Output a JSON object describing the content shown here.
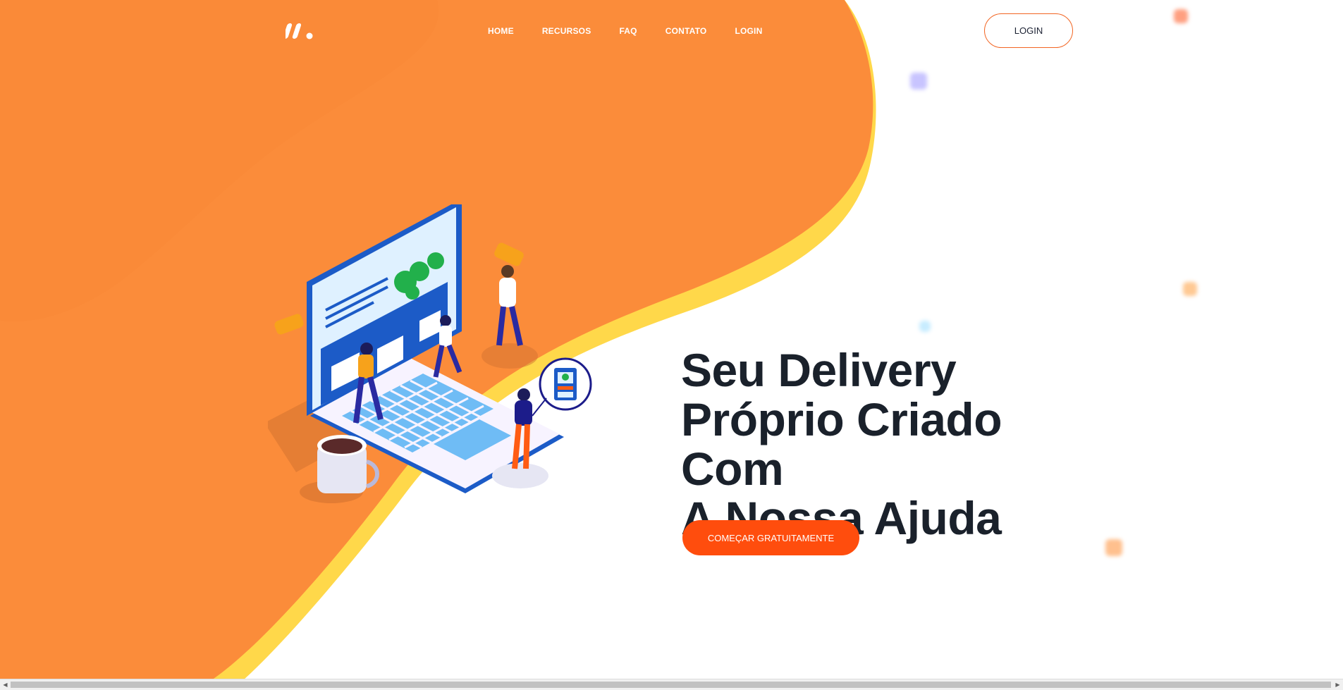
{
  "nav": {
    "items": [
      "HOME",
      "RECURSOS",
      "FAQ",
      "CONTATO",
      "LOGIN"
    ]
  },
  "header": {
    "login_button": "LOGIN"
  },
  "hero": {
    "headline_lines": [
      "Seu Delivery",
      "Próprio Criado Com",
      "A Nossa Ajuda"
    ],
    "cta_label": "COMEÇAR GRATUITAMENTE"
  },
  "colors": {
    "primary_orange": "#fb8c3a",
    "accent_yellow": "#ffd84a",
    "cta": "#ff4d0d",
    "text_dark": "#1a212b"
  },
  "icons": {
    "logo": "brand-logo-icon",
    "scroll_left": "scroll-left-icon",
    "scroll_right": "scroll-right-icon"
  }
}
